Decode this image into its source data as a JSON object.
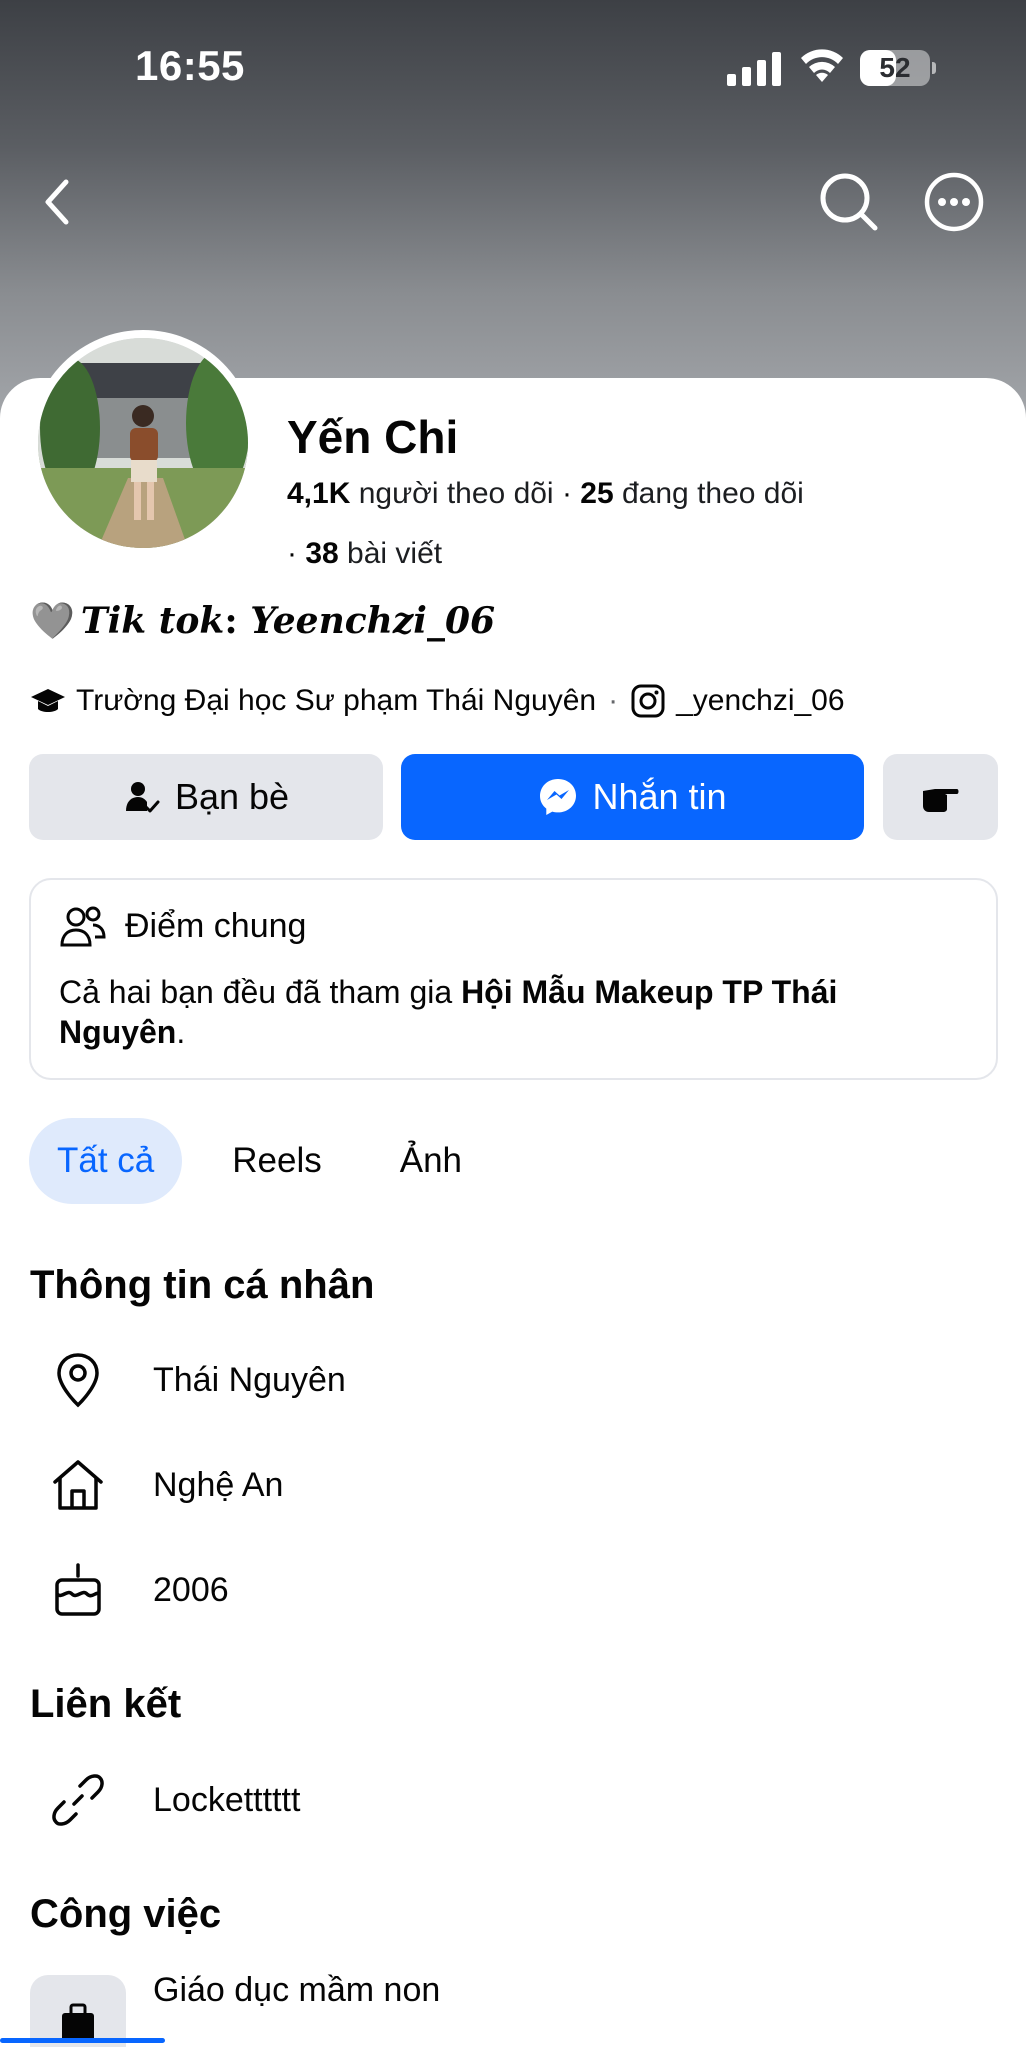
{
  "status_bar": {
    "time": "16:55",
    "battery_level": "52"
  },
  "header": {
    "back_icon": "chevron-left-icon",
    "search_icon": "search-icon",
    "more_icon": "more-dots-icon"
  },
  "profile": {
    "name": "Yến Chi",
    "followers_count": "4,1K",
    "followers_label": "người theo dõi",
    "following_count": "25",
    "following_label": "đang theo dõi",
    "posts_count": "38",
    "posts_label": "bài viết",
    "bio_heart": "🩶",
    "bio_label": "Tik tok",
    "bio_value": "Yeenchzi_06",
    "school": "Trường Đại học Sư phạm Thái Nguyên",
    "instagram": "_yenchzi_06"
  },
  "actions": {
    "friends_label": "Bạn bè",
    "message_label": "Nhắn tin"
  },
  "mutual": {
    "title": "Điểm chung",
    "text_prefix": "Cả hai bạn đều đã tham gia ",
    "group_name": "Hội Mẫu Makeup TP Thái Nguyên",
    "text_suffix": "."
  },
  "tabs": [
    {
      "label": "Tất cả",
      "active": true
    },
    {
      "label": "Reels",
      "active": false
    },
    {
      "label": "Ảnh",
      "active": false
    }
  ],
  "personal_info": {
    "title": "Thông tin cá nhân",
    "location": "Thái Nguyên",
    "hometown": "Nghệ An",
    "birth_year": "2006"
  },
  "links": {
    "title": "Liên kết",
    "item": "Locketttttt"
  },
  "work": {
    "title": "Công việc",
    "item": "Giáo dục mầm non"
  },
  "colors": {
    "primary": "#0866ff",
    "button_gray": "#e4e6eb",
    "active_tab_bg": "#dfeafc"
  }
}
